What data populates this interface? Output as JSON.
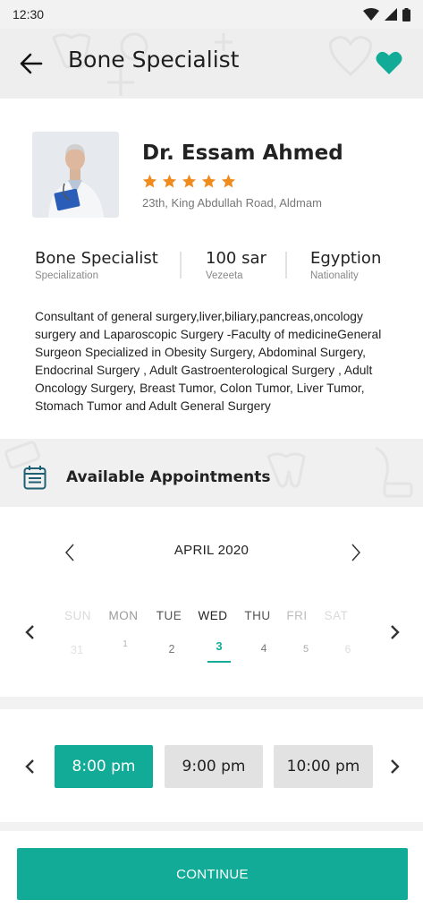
{
  "status_bar": {
    "time": "12:30"
  },
  "header": {
    "title": "Bone Specialist"
  },
  "doctor": {
    "name": "Dr. Essam Ahmed",
    "rating": 5,
    "address": "23th, King Abdullah Road, Aldmam",
    "facts": [
      {
        "value": "Bone Specialist",
        "label": "Specialization"
      },
      {
        "value": "100 sar",
        "label": "Vezeeta"
      },
      {
        "value": "Egyption",
        "label": "Nationality"
      }
    ],
    "bio": "Consultant of general surgery,liver,biliary,pancreas,oncology surgery and Laparoscopic Surgery -Faculty of medicineGeneral Surgeon Specialized in Obesity Surgery, Abdominal Surgery, Endocrinal Surgery , Adult Gastroenterological Surgery , Adult Oncology Surgery, Breast Tumor, Colon Tumor, Liver Tumor, Stomach Tumor and Adult General Surgery"
  },
  "appointments": {
    "title": "Available Appointments"
  },
  "calendar": {
    "month": "APRIL  2020",
    "days": [
      {
        "name": "SUN",
        "date": "31",
        "state": "disabled"
      },
      {
        "name": "MON",
        "date": "1",
        "state": "past"
      },
      {
        "name": "TUE",
        "date": "2",
        "state": "normal"
      },
      {
        "name": "WED",
        "date": "3",
        "state": "selected"
      },
      {
        "name": "THU",
        "date": "4",
        "state": "normal"
      },
      {
        "name": "FRI",
        "date": "5",
        "state": "past"
      },
      {
        "name": "SAT",
        "date": "6",
        "state": "disabled"
      }
    ]
  },
  "time_slots": [
    {
      "label": "8:00 pm",
      "selected": true
    },
    {
      "label": "9:00 pm",
      "selected": false
    },
    {
      "label": "10:00 pm",
      "selected": false
    }
  ],
  "footer": {
    "continue_label": "CONTINUE"
  },
  "colors": {
    "accent": "#12ab97",
    "star": "#f08c1e"
  }
}
